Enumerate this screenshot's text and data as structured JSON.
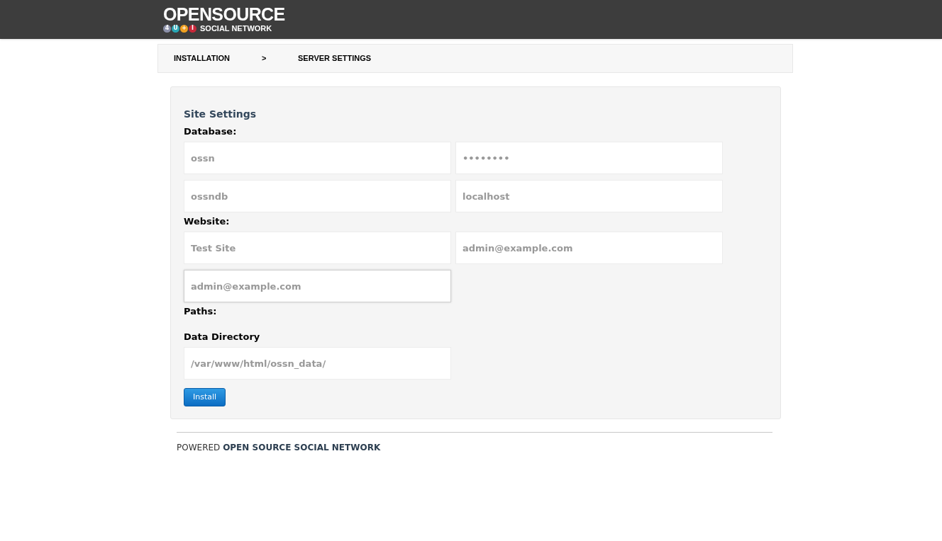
{
  "logo": {
    "title": "OPENSOURCE",
    "badges": [
      {
        "text": "4",
        "color": "#8a8fa8"
      },
      {
        "text": "U",
        "color": "#2aa7b5"
      },
      {
        "text": "+",
        "color": "#f0a020"
      },
      {
        "text": "I",
        "color": "#c8283a"
      }
    ],
    "subtitle": "SOCIAL NETWORK"
  },
  "breadcrumb": [
    "INSTALLATION",
    ">",
    "SERVER SETTINGS"
  ],
  "form": {
    "title": "Site Settings",
    "sections": [
      {
        "heading": "Database:",
        "fields": [
          {
            "value": "ossn",
            "focused": false
          },
          {
            "value": "••••••••",
            "focused": false
          },
          {
            "value": "ossndb",
            "focused": false
          },
          {
            "value": "localhost",
            "focused": false
          }
        ]
      },
      {
        "heading": "Website:",
        "fields": [
          {
            "value": "Test Site",
            "focused": false
          },
          {
            "value": "admin@example.com",
            "focused": false
          },
          {
            "value": "admin@example.com",
            "focused": true
          }
        ]
      },
      {
        "heading": "Paths:",
        "subheading": "Data Directory",
        "fields": [
          {
            "value": "/var/www/html/ossn_data/",
            "focused": false
          }
        ]
      }
    ],
    "button": "Install"
  },
  "footer": {
    "prefix": "POWERED",
    "link": "OPEN SOURCE SOCIAL NETWORK"
  }
}
